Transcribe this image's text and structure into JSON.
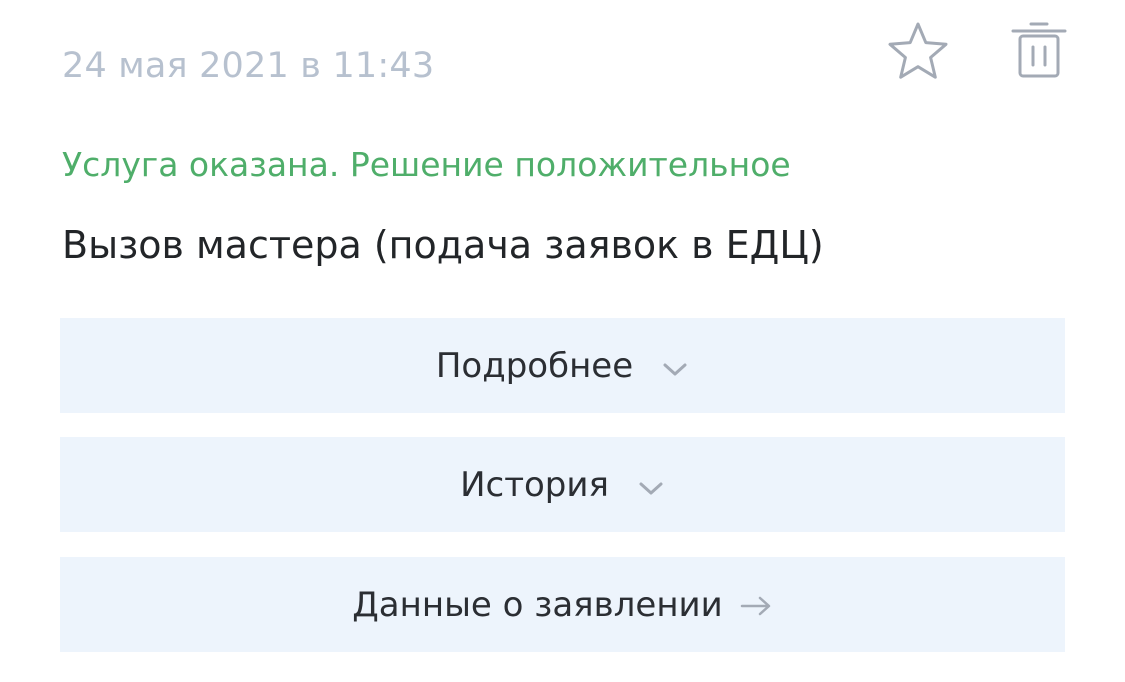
{
  "request": {
    "date": "24 мая 2021 в 11:43",
    "status": "Услуга оказана. Решение положительное",
    "title": "Вызов мастера (подача заявок в ЕДЦ)"
  },
  "actions": {
    "details_label": "Подробнее",
    "history_label": "История",
    "application_data_label": "Данные о заявлении"
  },
  "icons": {
    "favorite": "star-outline-icon",
    "delete": "trash-icon",
    "expand": "chevron-down-icon",
    "navigate": "arrow-right-icon"
  },
  "colors": {
    "status_positive": "#4fae6a",
    "date_text": "#b7c1cf",
    "action_background": "#edf4fc",
    "icon_gray": "#a3aab5"
  }
}
